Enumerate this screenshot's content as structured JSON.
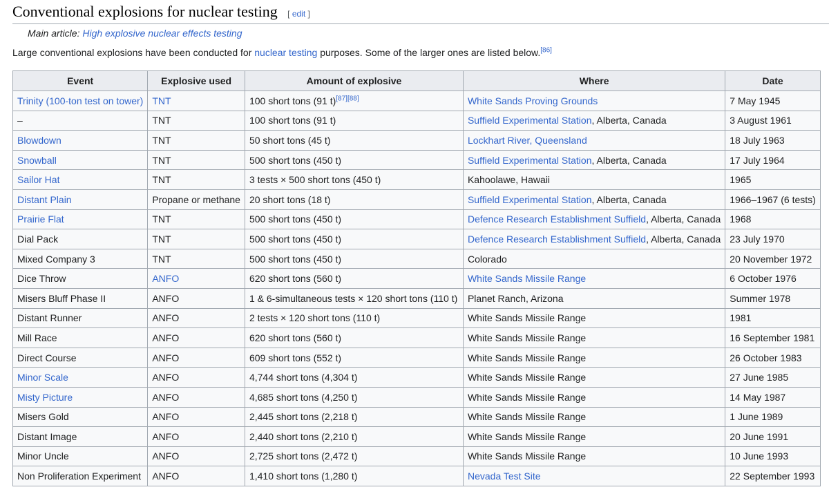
{
  "section": {
    "title": "Conventional explosions for nuclear testing",
    "edit_open": "[ ",
    "edit_label": "edit",
    "edit_close": " ]"
  },
  "hatnote": {
    "prefix": "Main article: ",
    "link": "High explosive nuclear effects testing"
  },
  "intro": {
    "before": "Large conventional explosions have been conducted for ",
    "link": "nuclear testing",
    "after": " purposes. Some of the larger ones are listed below.",
    "ref": "[86]"
  },
  "table": {
    "headers": [
      "Event",
      "Explosive used",
      "Amount of explosive",
      "Where",
      "Date"
    ],
    "rows": [
      {
        "event": "Trinity (100-ton test on tower)",
        "event_link": true,
        "explosive": "TNT",
        "explosive_link": true,
        "amount": "100 short tons (91 t)",
        "amount_refs": "[87][88]",
        "where_link": "White Sands Proving Grounds",
        "where_rest": "",
        "date": "7 May 1945"
      },
      {
        "event": "–",
        "event_link": false,
        "explosive": "TNT",
        "explosive_link": false,
        "amount": "100 short tons (91 t)",
        "amount_refs": "",
        "where_link": "Suffield Experimental Station",
        "where_rest": ", Alberta, Canada",
        "date": "3 August 1961"
      },
      {
        "event": "Blowdown",
        "event_link": true,
        "explosive": "TNT",
        "explosive_link": false,
        "amount": "50 short tons (45 t)",
        "amount_refs": "",
        "where_link": "Lockhart River, Queensland",
        "where_rest": "",
        "date": "18 July 1963"
      },
      {
        "event": "Snowball",
        "event_link": true,
        "explosive": "TNT",
        "explosive_link": false,
        "amount": "500 short tons (450 t)",
        "amount_refs": "",
        "where_link": "Suffield Experimental Station",
        "where_rest": ", Alberta, Canada",
        "date": "17 July 1964"
      },
      {
        "event": "Sailor Hat",
        "event_link": true,
        "explosive": "TNT",
        "explosive_link": false,
        "amount": "3 tests × 500 short tons (450 t)",
        "amount_refs": "",
        "where_link": "",
        "where_rest": "Kahoolawe, Hawaii",
        "date": "1965"
      },
      {
        "event": "Distant Plain",
        "event_link": true,
        "explosive": "Propane or methane",
        "explosive_link": false,
        "amount": "20 short tons (18 t)",
        "amount_refs": "",
        "where_link": "Suffield Experimental Station",
        "where_rest": ", Alberta, Canada",
        "date": "1966–1967 (6 tests)"
      },
      {
        "event": "Prairie Flat",
        "event_link": true,
        "explosive": "TNT",
        "explosive_link": false,
        "amount": "500 short tons (450 t)",
        "amount_refs": "",
        "where_link": "Defence Research Establishment Suffield",
        "where_rest": ", Alberta, Canada",
        "date": "1968"
      },
      {
        "event": "Dial Pack",
        "event_link": false,
        "explosive": "TNT",
        "explosive_link": false,
        "amount": "500 short tons (450 t)",
        "amount_refs": "",
        "where_link": "Defence Research Establishment Suffield",
        "where_rest": ", Alberta, Canada",
        "date": "23 July 1970"
      },
      {
        "event": "Mixed Company 3",
        "event_link": false,
        "explosive": "TNT",
        "explosive_link": false,
        "amount": "500 short tons (450 t)",
        "amount_refs": "",
        "where_link": "",
        "where_rest": "Colorado",
        "date": "20 November 1972"
      },
      {
        "event": "Dice Throw",
        "event_link": false,
        "explosive": "ANFO",
        "explosive_link": true,
        "amount": "620 short tons (560 t)",
        "amount_refs": "",
        "where_link": "White Sands Missile Range",
        "where_rest": "",
        "date": "6 October 1976"
      },
      {
        "event": "Misers Bluff Phase II",
        "event_link": false,
        "explosive": "ANFO",
        "explosive_link": false,
        "amount": "1 & 6-simultaneous tests × 120 short tons (110 t)",
        "amount_refs": "",
        "where_link": "",
        "where_rest": "Planet Ranch, Arizona",
        "date": "Summer 1978"
      },
      {
        "event": "Distant Runner",
        "event_link": false,
        "explosive": "ANFO",
        "explosive_link": false,
        "amount": "2 tests × 120 short tons (110 t)",
        "amount_refs": "",
        "where_link": "",
        "where_rest": "White Sands Missile Range",
        "date": "1981"
      },
      {
        "event": "Mill Race",
        "event_link": false,
        "explosive": "ANFO",
        "explosive_link": false,
        "amount": "620 short tons (560 t)",
        "amount_refs": "",
        "where_link": "",
        "where_rest": "White Sands Missile Range",
        "date": "16 September 1981"
      },
      {
        "event": "Direct Course",
        "event_link": false,
        "explosive": "ANFO",
        "explosive_link": false,
        "amount": "609 short tons (552 t)",
        "amount_refs": "",
        "where_link": "",
        "where_rest": "White Sands Missile Range",
        "date": "26 October 1983"
      },
      {
        "event": "Minor Scale",
        "event_link": true,
        "explosive": "ANFO",
        "explosive_link": false,
        "amount": "4,744 short tons (4,304 t)",
        "amount_refs": "",
        "where_link": "",
        "where_rest": "White Sands Missile Range",
        "date": "27 June 1985"
      },
      {
        "event": "Misty Picture",
        "event_link": true,
        "explosive": "ANFO",
        "explosive_link": false,
        "amount": "4,685 short tons (4,250 t)",
        "amount_refs": "",
        "where_link": "",
        "where_rest": "White Sands Missile Range",
        "date": "14 May 1987"
      },
      {
        "event": "Misers Gold",
        "event_link": false,
        "explosive": "ANFO",
        "explosive_link": false,
        "amount": "2,445 short tons (2,218 t)",
        "amount_refs": "",
        "where_link": "",
        "where_rest": "White Sands Missile Range",
        "date": "1 June 1989"
      },
      {
        "event": "Distant Image",
        "event_link": false,
        "explosive": "ANFO",
        "explosive_link": false,
        "amount": "2,440 short tons (2,210 t)",
        "amount_refs": "",
        "where_link": "",
        "where_rest": "White Sands Missile Range",
        "date": "20 June 1991"
      },
      {
        "event": "Minor Uncle",
        "event_link": false,
        "explosive": "ANFO",
        "explosive_link": false,
        "amount": "2,725 short tons (2,472 t)",
        "amount_refs": "",
        "where_link": "",
        "where_rest": "White Sands Missile Range",
        "date": "10 June 1993"
      },
      {
        "event": "Non Proliferation Experiment",
        "event_link": false,
        "explosive": "ANFO",
        "explosive_link": false,
        "amount": "1,410 short tons (1,280 t)",
        "amount_refs": "",
        "where_link": "Nevada Test Site",
        "where_rest": "",
        "date": "22 September 1993"
      }
    ]
  },
  "colors": {
    "link": "#3366cc",
    "text": "#202122",
    "header_bg": "#eaecf0",
    "cell_bg": "#f8f9fa",
    "border": "#a2a9b1"
  }
}
